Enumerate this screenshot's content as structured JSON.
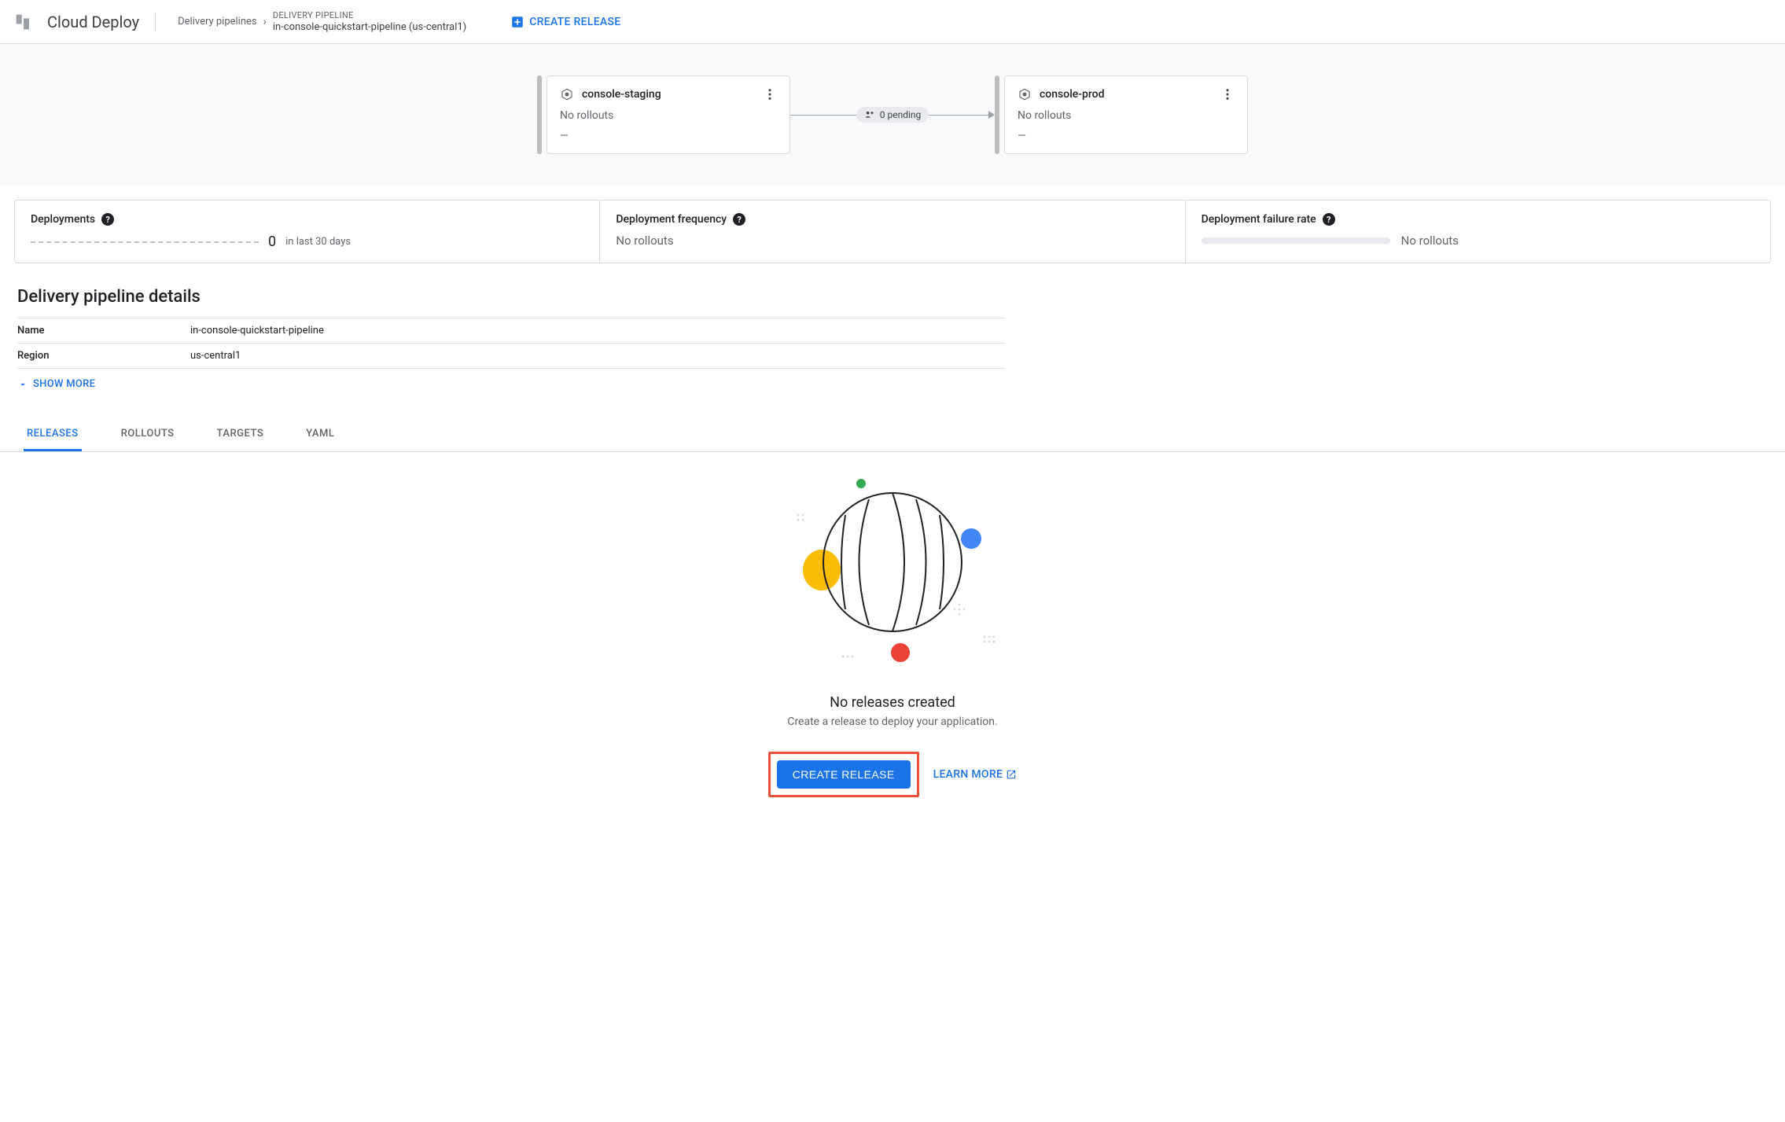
{
  "header": {
    "product_name": "Cloud Deploy",
    "breadcrumb_link": "Delivery pipelines",
    "breadcrumb_label": "DELIVERY PIPELINE",
    "breadcrumb_current": "in-console-quickstart-pipeline (us-central1)",
    "create_release_label": "CREATE RELEASE"
  },
  "pipeline": {
    "targets": [
      {
        "name": "console-staging",
        "status": "No rollouts",
        "dash": "—"
      },
      {
        "name": "console-prod",
        "status": "No rollouts",
        "dash": "—"
      }
    ],
    "pending_label": "0 pending"
  },
  "stats": {
    "deployments_label": "Deployments",
    "deployments_count": "0",
    "deployments_period": "in last 30 days",
    "frequency_label": "Deployment frequency",
    "frequency_value": "No rollouts",
    "failure_label": "Deployment failure rate",
    "failure_value": "No rollouts"
  },
  "details": {
    "title": "Delivery pipeline details",
    "rows": {
      "name_label": "Name",
      "name_value": "in-console-quickstart-pipeline",
      "region_label": "Region",
      "region_value": "us-central1"
    },
    "show_more": "SHOW MORE"
  },
  "tabs": {
    "releases": "RELEASES",
    "rollouts": "ROLLOUTS",
    "targets": "TARGETS",
    "yaml": "YAML"
  },
  "empty": {
    "title": "No releases created",
    "subtitle": "Create a release to deploy your application.",
    "create_button": "CREATE RELEASE",
    "learn_more": "LEARN MORE"
  }
}
